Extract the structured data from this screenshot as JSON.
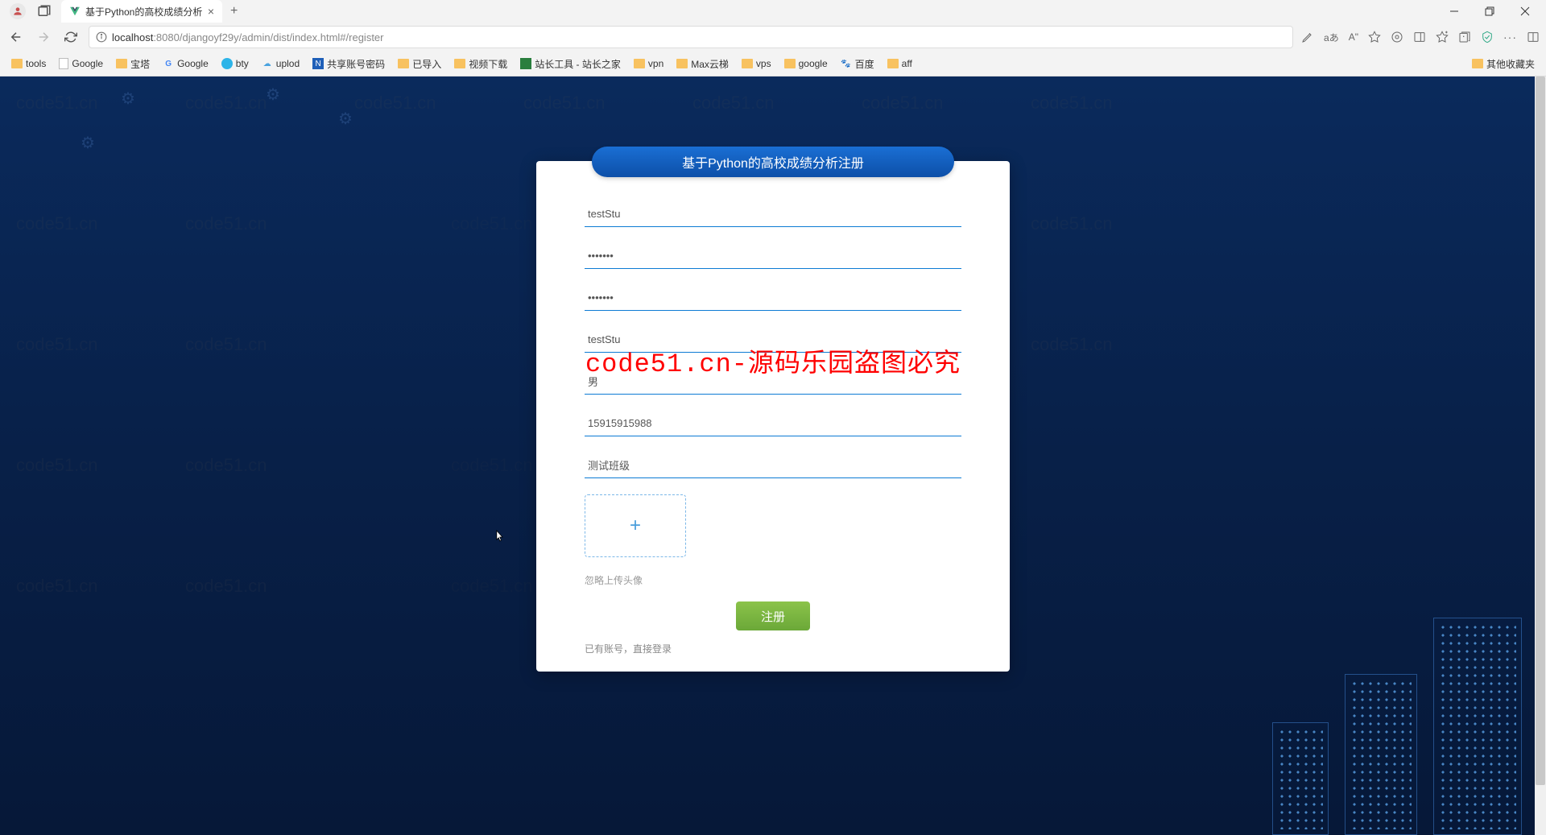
{
  "browser": {
    "tab_title": "基于Python的高校成绩分析",
    "url_host": "localhost",
    "url_port": ":8080",
    "url_path": "/djangoyf29y/admin/dist/index.html#/register",
    "font_badge": "aあ",
    "read_badge": "A\""
  },
  "bookmarks": {
    "items": [
      {
        "label": "tools",
        "type": "folder"
      },
      {
        "label": "Google",
        "type": "page"
      },
      {
        "label": "宝塔",
        "type": "folder"
      },
      {
        "label": "Google",
        "type": "g"
      },
      {
        "label": "bty",
        "type": "bty"
      },
      {
        "label": "uplod",
        "type": "cloud"
      },
      {
        "label": "共享账号密码",
        "type": "blue"
      },
      {
        "label": "已导入",
        "type": "folder"
      },
      {
        "label": "视频下载",
        "type": "folder"
      },
      {
        "label": "站长工具 - 站长之家",
        "type": "green"
      },
      {
        "label": "vpn",
        "type": "folder"
      },
      {
        "label": "Max云梯",
        "type": "folder"
      },
      {
        "label": "vps",
        "type": "folder"
      },
      {
        "label": "google",
        "type": "folder"
      },
      {
        "label": "百度",
        "type": "baidu"
      },
      {
        "label": "aff",
        "type": "folder"
      }
    ],
    "overflow": "其他收藏夹"
  },
  "form": {
    "header": "基于Python的高校成绩分析注册",
    "username": "testStu",
    "password": "•••••••",
    "password2": "•••••••",
    "name": "testStu",
    "gender": "男",
    "phone": "15915915988",
    "class": "测试班级",
    "upload_hint": "忽略上传头像",
    "submit": "注册",
    "login_link": "已有账号，直接登录"
  },
  "overlay": "code51.cn-源码乐园盗图必究",
  "watermark": "code51.cn"
}
